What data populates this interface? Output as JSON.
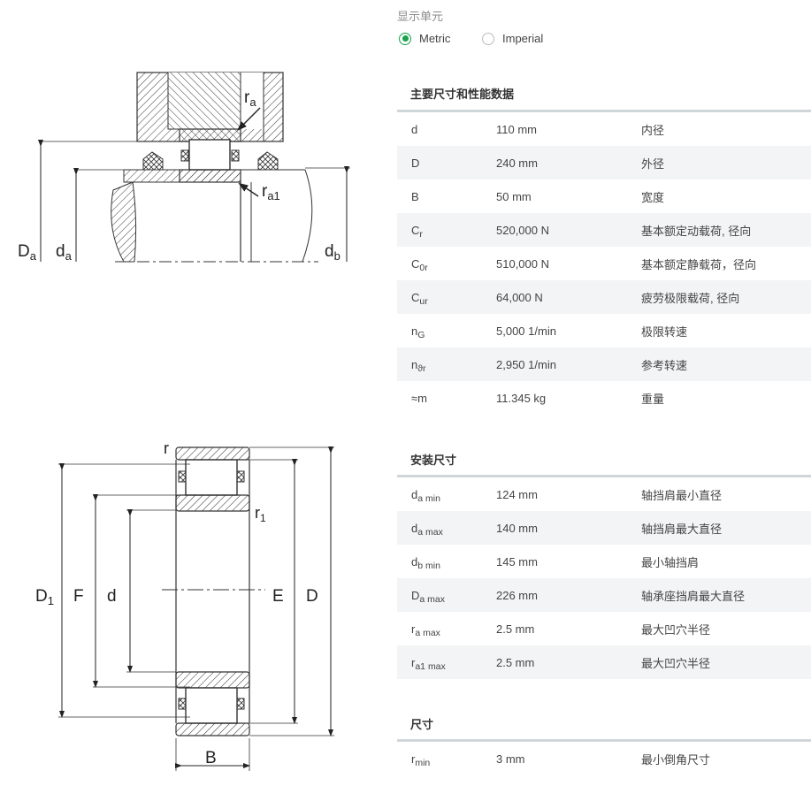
{
  "units": {
    "title": "显示单元",
    "options": [
      {
        "label": "Metric",
        "selected": true
      },
      {
        "label": "Imperial",
        "selected": false
      }
    ]
  },
  "sections": [
    {
      "title": "主要尺寸和性能数据",
      "rows": [
        {
          "sym": "d",
          "sub": "",
          "value": "110 mm",
          "desc": "内径"
        },
        {
          "sym": "D",
          "sub": "",
          "value": "240 mm",
          "desc": "外径"
        },
        {
          "sym": "B",
          "sub": "",
          "value": "50 mm",
          "desc": "宽度"
        },
        {
          "sym": "C",
          "sub": "r",
          "value": "520,000 N",
          "desc": "基本额定动载荷, 径向"
        },
        {
          "sym": "C",
          "sub": "0r",
          "value": "510,000 N",
          "desc": "基本额定静载荷，径向"
        },
        {
          "sym": "C",
          "sub": "ur",
          "value": "64,000 N",
          "desc": "疲劳极限载荷, 径向"
        },
        {
          "sym": "n",
          "sub": "G",
          "value": "5,000 1/min",
          "desc": "极限转速"
        },
        {
          "sym": "n",
          "sub": "ϑr",
          "value": "2,950 1/min",
          "desc": "参考转速"
        },
        {
          "sym": "≈m",
          "sub": "",
          "value": "11.345 kg",
          "desc": "重量"
        }
      ]
    },
    {
      "title": "安装尺寸",
      "rows": [
        {
          "sym": "d",
          "sub": "a min",
          "value": "124 mm",
          "desc": "轴挡肩最小直径"
        },
        {
          "sym": "d",
          "sub": "a max",
          "value": "140 mm",
          "desc": "轴挡肩最大直径"
        },
        {
          "sym": "d",
          "sub": "b min",
          "value": "145 mm",
          "desc": "最小轴挡肩"
        },
        {
          "sym": "D",
          "sub": "a max",
          "value": "226 mm",
          "desc": "轴承座挡肩最大直径"
        },
        {
          "sym": "r",
          "sub": "a max",
          "value": "2.5 mm",
          "desc": "最大凹穴半径"
        },
        {
          "sym": "r",
          "sub": "a1 max",
          "value": "2.5 mm",
          "desc": "最大凹穴半径"
        }
      ]
    },
    {
      "title": "尺寸",
      "rows": [
        {
          "sym": "r",
          "sub": "min",
          "value": "3 mm",
          "desc": "最小倒角尺寸"
        }
      ]
    }
  ],
  "drawing_top": {
    "labels": {
      "Da": "D",
      "Da_sub": "a",
      "da": "d",
      "da_sub": "a",
      "db": "d",
      "db_sub": "b",
      "ra": "r",
      "ra_sub": "a",
      "ra1": "r",
      "ra1_sub": "a1"
    }
  },
  "drawing_bottom": {
    "labels": {
      "r": "r",
      "r1": "r",
      "r1_sub": "1",
      "D1": "D",
      "D1_sub": "1",
      "F": "F",
      "d": "d",
      "E": "E",
      "D": "D",
      "B": "B"
    }
  }
}
